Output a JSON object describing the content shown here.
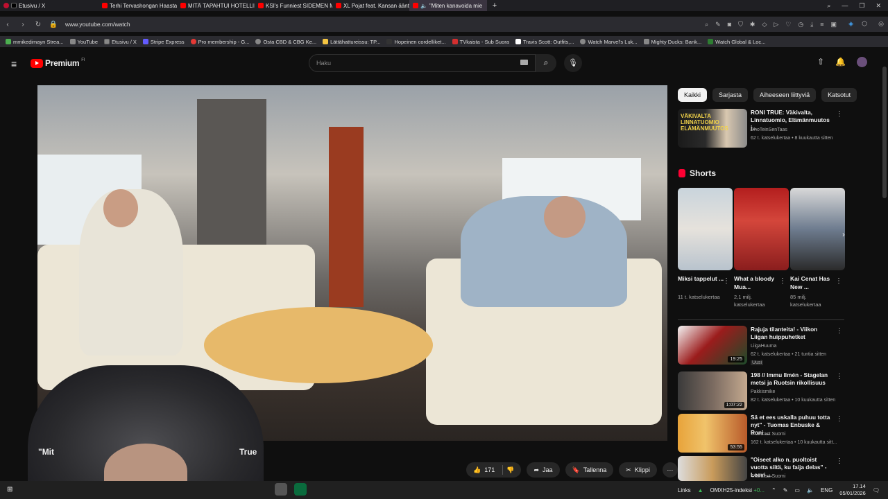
{
  "browser": {
    "tabs": [
      {
        "label": "Etusivu / X",
        "icon": "x-logo"
      },
      {
        "label": "Terhi Tervashongan Haasta",
        "icon": "youtube"
      },
      {
        "label": "MITÄ TAPAHTUI HOTELLIH",
        "icon": "youtube"
      },
      {
        "label": "KSI's Funniest SIDEMEN M",
        "icon": "youtube"
      },
      {
        "label": "XL Pojat feat. Kansan äänt",
        "icon": "youtube"
      },
      {
        "label": "\"Miten kanavoida mie",
        "icon": "youtube"
      }
    ],
    "new_tab": "+",
    "url": "www.youtube.com/watch",
    "bookmarks": [
      "mmikedimayn Strea...",
      "YouTube",
      "Etusivu / X",
      "Stripe Express",
      "Pro membership - G...",
      "Osta CBD & CBG Ke...",
      "Lättähattureissu: TP...",
      "Hopeinen cordelliket...",
      "TVkaista - Sub Suora",
      "Travis Scott: Outfits,...",
      "Watch Marvel's Luk...",
      "Mighty Ducks: Bank...",
      "Watch Global & Loc..."
    ]
  },
  "header": {
    "logo_text": "Premium",
    "logo_sup": "FI",
    "search_placeholder": "Haku"
  },
  "video": {
    "title_left": "\"Mit",
    "title_right": "True",
    "likes": "171",
    "share": "Jaa",
    "save": "Tallenna",
    "clip": "Klippi"
  },
  "sidebar": {
    "chips": [
      "Kaikki",
      "Sarjasta",
      "Aiheeseen liittyviä",
      "Katsotut"
    ],
    "top_rec": {
      "title": "RONI TRUE: Väkivalta, Linnatuomio, Elämänmuutos j...",
      "channel": "DhoTeinSenTaas",
      "meta": "62 t. katselukertaa • 8 kuukautta sitten"
    },
    "shorts_heading": "Shorts",
    "shorts": [
      {
        "title": "Miksi tappelut ...",
        "views": "11 t. katselukertaa"
      },
      {
        "title": "What a bloody Mua...",
        "views": "2,1 milj. katselukertaa"
      },
      {
        "title": "Kai Cenat Has New ...",
        "views": "85 milj. katselukertaa"
      }
    ],
    "recs": [
      {
        "title": "Rajuja tilanteita! - Viikon Liigan huippuhetket",
        "channel": "LiigaHuuma",
        "meta": "62 t. katselukertaa • 21 tuntia sitten",
        "extra": "Uusi",
        "duration": "19:25"
      },
      {
        "title": "198 // Immu Ilmén - Stagelan metsi ja Ruotsin rikollisuus",
        "channel": "Pakkismike",
        "meta": "82 t. katselukertaa • 10 kuukautta sitten",
        "extra": "",
        "duration": "1:07:22"
      },
      {
        "title": "Sä et ees uskalla puhuu totta nyt\" - Tuomas Enbuske & Roni ...",
        "channel": "TrueCast Suomi",
        "meta": "162 t. katselukertaa • 10 kuukautta sitt...",
        "extra": "",
        "duration": "53:55"
      },
      {
        "title": "\"Oiseet alko n. puoltoist vuotta siitä, ku faija delas\" - Leevi ...",
        "channel": "TrueCast Suomi",
        "meta": "",
        "extra": "",
        "duration": ""
      }
    ]
  },
  "taskbar": {
    "links": "Links",
    "stock": "OMXH25-indeksi",
    "stock_change": "+0...",
    "lang": "ENG",
    "time": "17.14",
    "date": "05/01/2026"
  },
  "colors": {
    "accent": "#ff0000",
    "background": "#0f0f0f"
  }
}
